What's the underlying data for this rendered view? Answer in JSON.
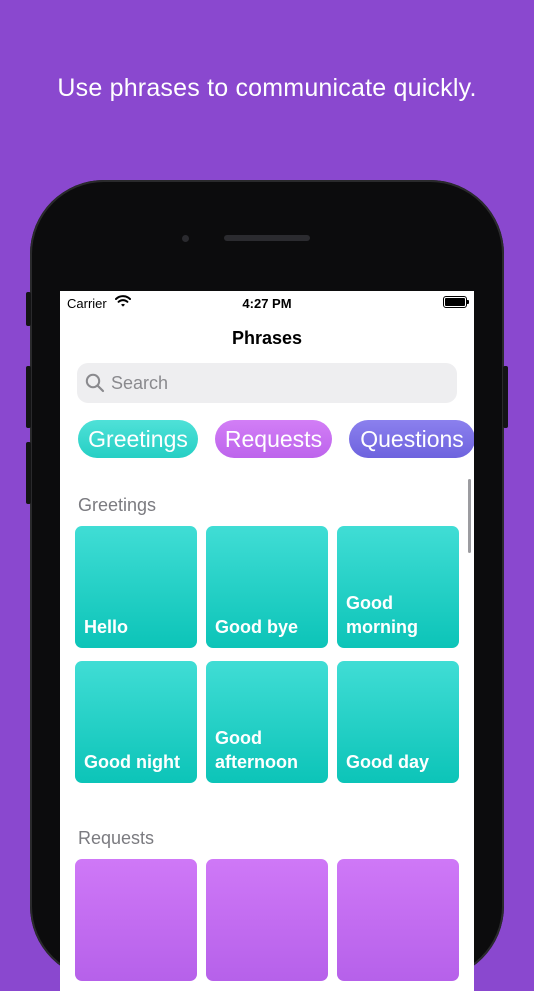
{
  "headline": "Use phrases to communicate quickly.",
  "status_bar": {
    "carrier": "Carrier",
    "time": "4:27 PM"
  },
  "nav": {
    "title": "Phrases"
  },
  "search": {
    "placeholder": "Search",
    "value": ""
  },
  "chips": [
    {
      "label": "Greetings",
      "color": "#3fd9d0"
    },
    {
      "label": "Requests",
      "color": "#c56cf0"
    },
    {
      "label": "Questions",
      "color": "#7a6fe6"
    }
  ],
  "sections": [
    {
      "title": "Greetings",
      "color": "#12c7bb",
      "phrases": [
        "Hello",
        "Good bye",
        "Good morning",
        "Good night",
        "Good afternoon",
        "Good day"
      ]
    },
    {
      "title": "Requests",
      "color": "#bf68ee",
      "phrases": [
        "",
        "",
        ""
      ]
    }
  ]
}
